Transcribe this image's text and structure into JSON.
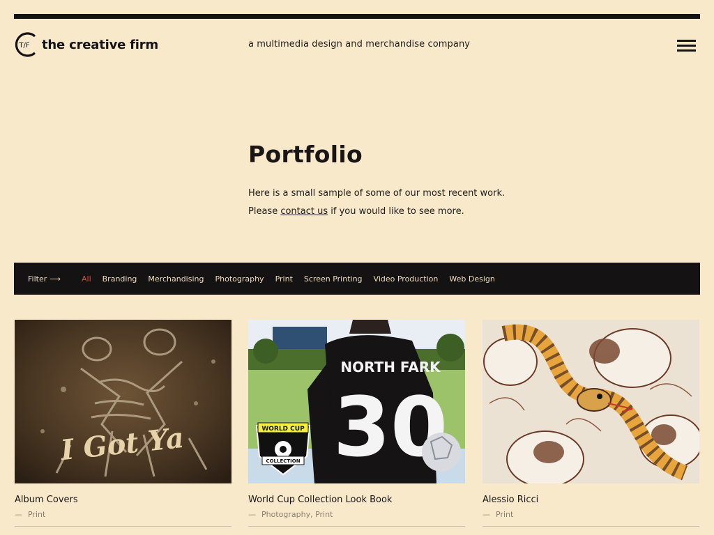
{
  "header": {
    "logo_mark": "T/F",
    "logo_text": "the creative firm",
    "tagline": "a multimedia design and merchandise company",
    "menu_icon": "hamburger-icon"
  },
  "intro": {
    "title": "Portfolio",
    "line1": "Here is a small sample of some of our most recent work.",
    "line2_before": "Please ",
    "line2_link": "contact us",
    "line2_after": " if you would like to see more."
  },
  "filter": {
    "label": "Filter",
    "arrow": "⟶",
    "items": [
      {
        "label": "All",
        "active": true
      },
      {
        "label": "Branding"
      },
      {
        "label": "Merchandising"
      },
      {
        "label": "Photography"
      },
      {
        "label": "Print"
      },
      {
        "label": "Screen Printing"
      },
      {
        "label": "Video Production"
      },
      {
        "label": "Web Design"
      }
    ],
    "active_color": "#e8413a"
  },
  "projects": [
    {
      "title": "Album Covers",
      "tags": "Print",
      "image_text": "I Got Ya"
    },
    {
      "title": "World Cup Collection Look Book",
      "tags": "Photography, Print",
      "image_text": {
        "jersey_name": "NORTH FARK",
        "jersey_number": "30",
        "badge_top": "WORLD CUP",
        "badge_bottom": "COLLECTION"
      }
    },
    {
      "title": "Alessio Ricci",
      "tags": "Print"
    }
  ],
  "colors": {
    "background": "#f7e9c9",
    "dark": "#151213",
    "accent": "#e8413a"
  }
}
